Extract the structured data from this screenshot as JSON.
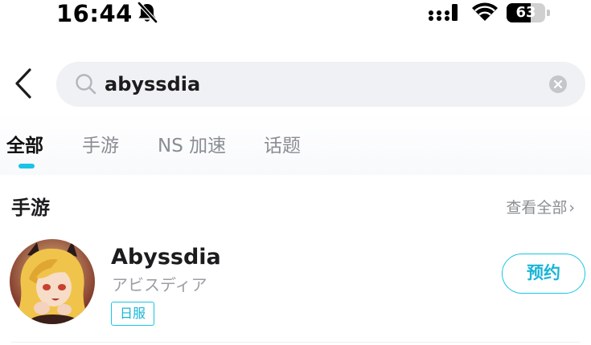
{
  "status_bar": {
    "time": "16:44",
    "battery_level": "63",
    "battery_fraction": 0.63,
    "icons": [
      "bell-off-icon",
      "signal-icon",
      "wifi-icon",
      "battery-icon"
    ]
  },
  "search": {
    "query": "abyssdia",
    "icons": [
      "back-chevron-icon",
      "search-icon",
      "clear-icon"
    ]
  },
  "tabs": [
    {
      "label": "全部",
      "active": true
    },
    {
      "label": "手游",
      "active": false
    },
    {
      "label": "NS 加速",
      "active": false
    },
    {
      "label": "话题",
      "active": false
    }
  ],
  "section": {
    "title": "手游",
    "view_all": "查看全部",
    "view_all_chevron": "›"
  },
  "game": {
    "title": "Abyssdia",
    "subtitle": "アビスディア",
    "region_badge": "日服",
    "action_label": "预约"
  },
  "colors": {
    "accent": "#19c4e6",
    "muted_text": "#8a8d93",
    "search_bg": "#f0f1f4"
  }
}
